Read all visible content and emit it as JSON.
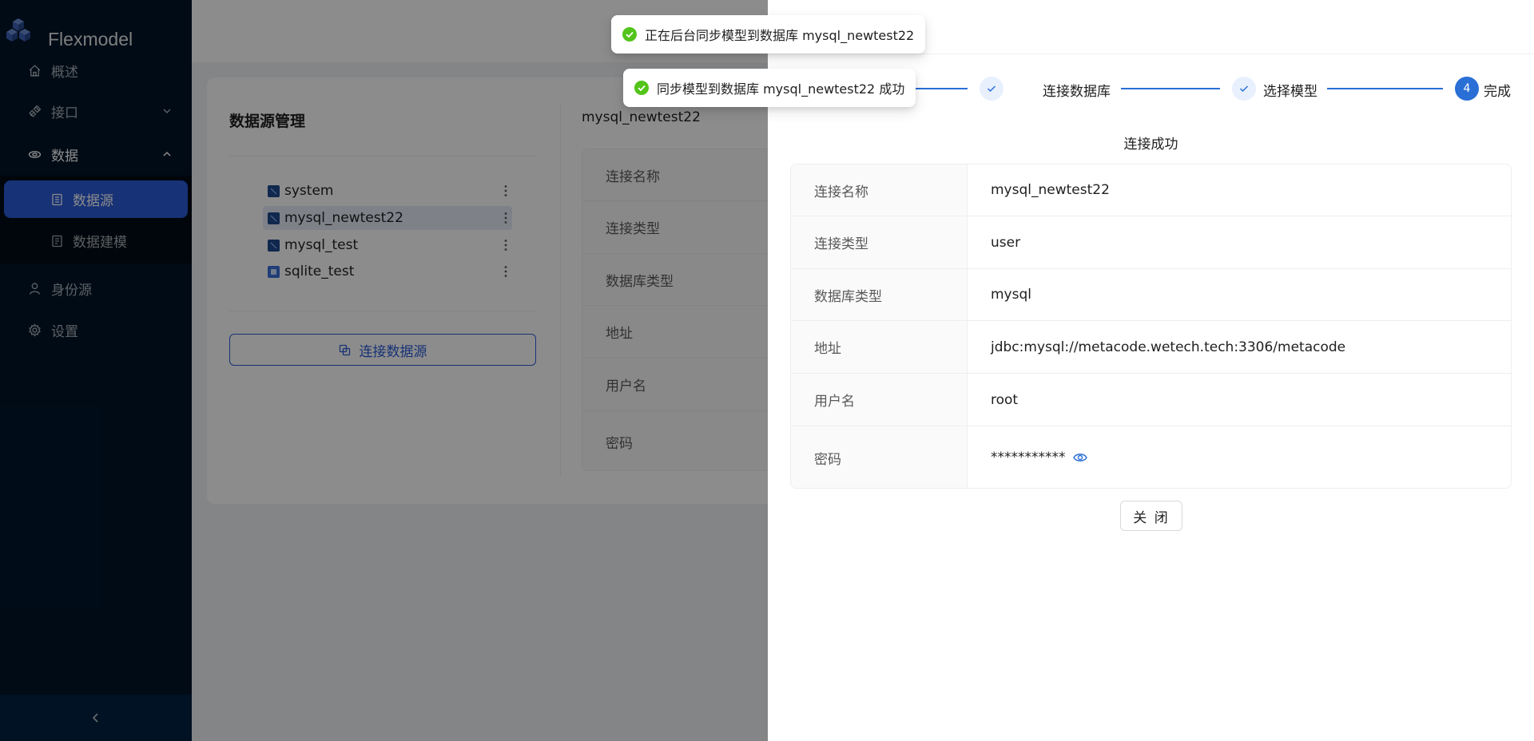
{
  "app": {
    "name": "Flexmodel"
  },
  "colors": {
    "sidebar_bg": "#001529",
    "accent": "#2a5bd7",
    "success": "#52c41a"
  },
  "sidebar": {
    "items": [
      {
        "label": "概述",
        "icon": "home-icon"
      },
      {
        "label": "接口",
        "icon": "api-link-icon"
      },
      {
        "label": "数据",
        "icon": "database-icon"
      },
      {
        "label": "身份源",
        "icon": "user-icon"
      },
      {
        "label": "设置",
        "icon": "gear-icon"
      }
    ],
    "data_submenu": [
      {
        "label": "数据源",
        "icon": "datasource-icon",
        "active": true
      },
      {
        "label": "数据建模",
        "icon": "modeling-icon",
        "active": false
      }
    ],
    "collapse_label": "<"
  },
  "datasource_panel": {
    "title": "数据源管理",
    "items": [
      {
        "name": "system",
        "type": "mysql"
      },
      {
        "name": "mysql_newtest22",
        "type": "mysql",
        "selected": true
      },
      {
        "name": "mysql_test",
        "type": "mysql"
      },
      {
        "name": "sqlite_test",
        "type": "sqlite"
      }
    ],
    "connect_button": "连接数据源"
  },
  "detail": {
    "header": "mysql_newtest22",
    "labels": [
      "连接名称",
      "连接类型",
      "数据库类型",
      "地址",
      "用户名",
      "密码"
    ]
  },
  "toasts": [
    {
      "text": "正在后台同步模型到数据库 mysql_newtest22"
    },
    {
      "text": "同步模型到数据库 mysql_newtest22 成功"
    }
  ],
  "drawer": {
    "steps": [
      {
        "label": "连接数据库",
        "status": "done"
      },
      {
        "label": "选择模型",
        "status": "done"
      },
      {
        "label": "完成",
        "status": "current",
        "number": "4"
      }
    ],
    "subtitle": "连接成功",
    "rows": [
      {
        "label": "连接名称",
        "value": "mysql_newtest22"
      },
      {
        "label": "连接类型",
        "value": "user"
      },
      {
        "label": "数据库类型",
        "value": "mysql"
      },
      {
        "label": "地址",
        "value": "jdbc:mysql://metacode.wetech.tech:3306/metacode"
      },
      {
        "label": "用户名",
        "value": "root"
      },
      {
        "label": "密码",
        "value": "***********"
      }
    ],
    "close_button": "关 闭"
  }
}
